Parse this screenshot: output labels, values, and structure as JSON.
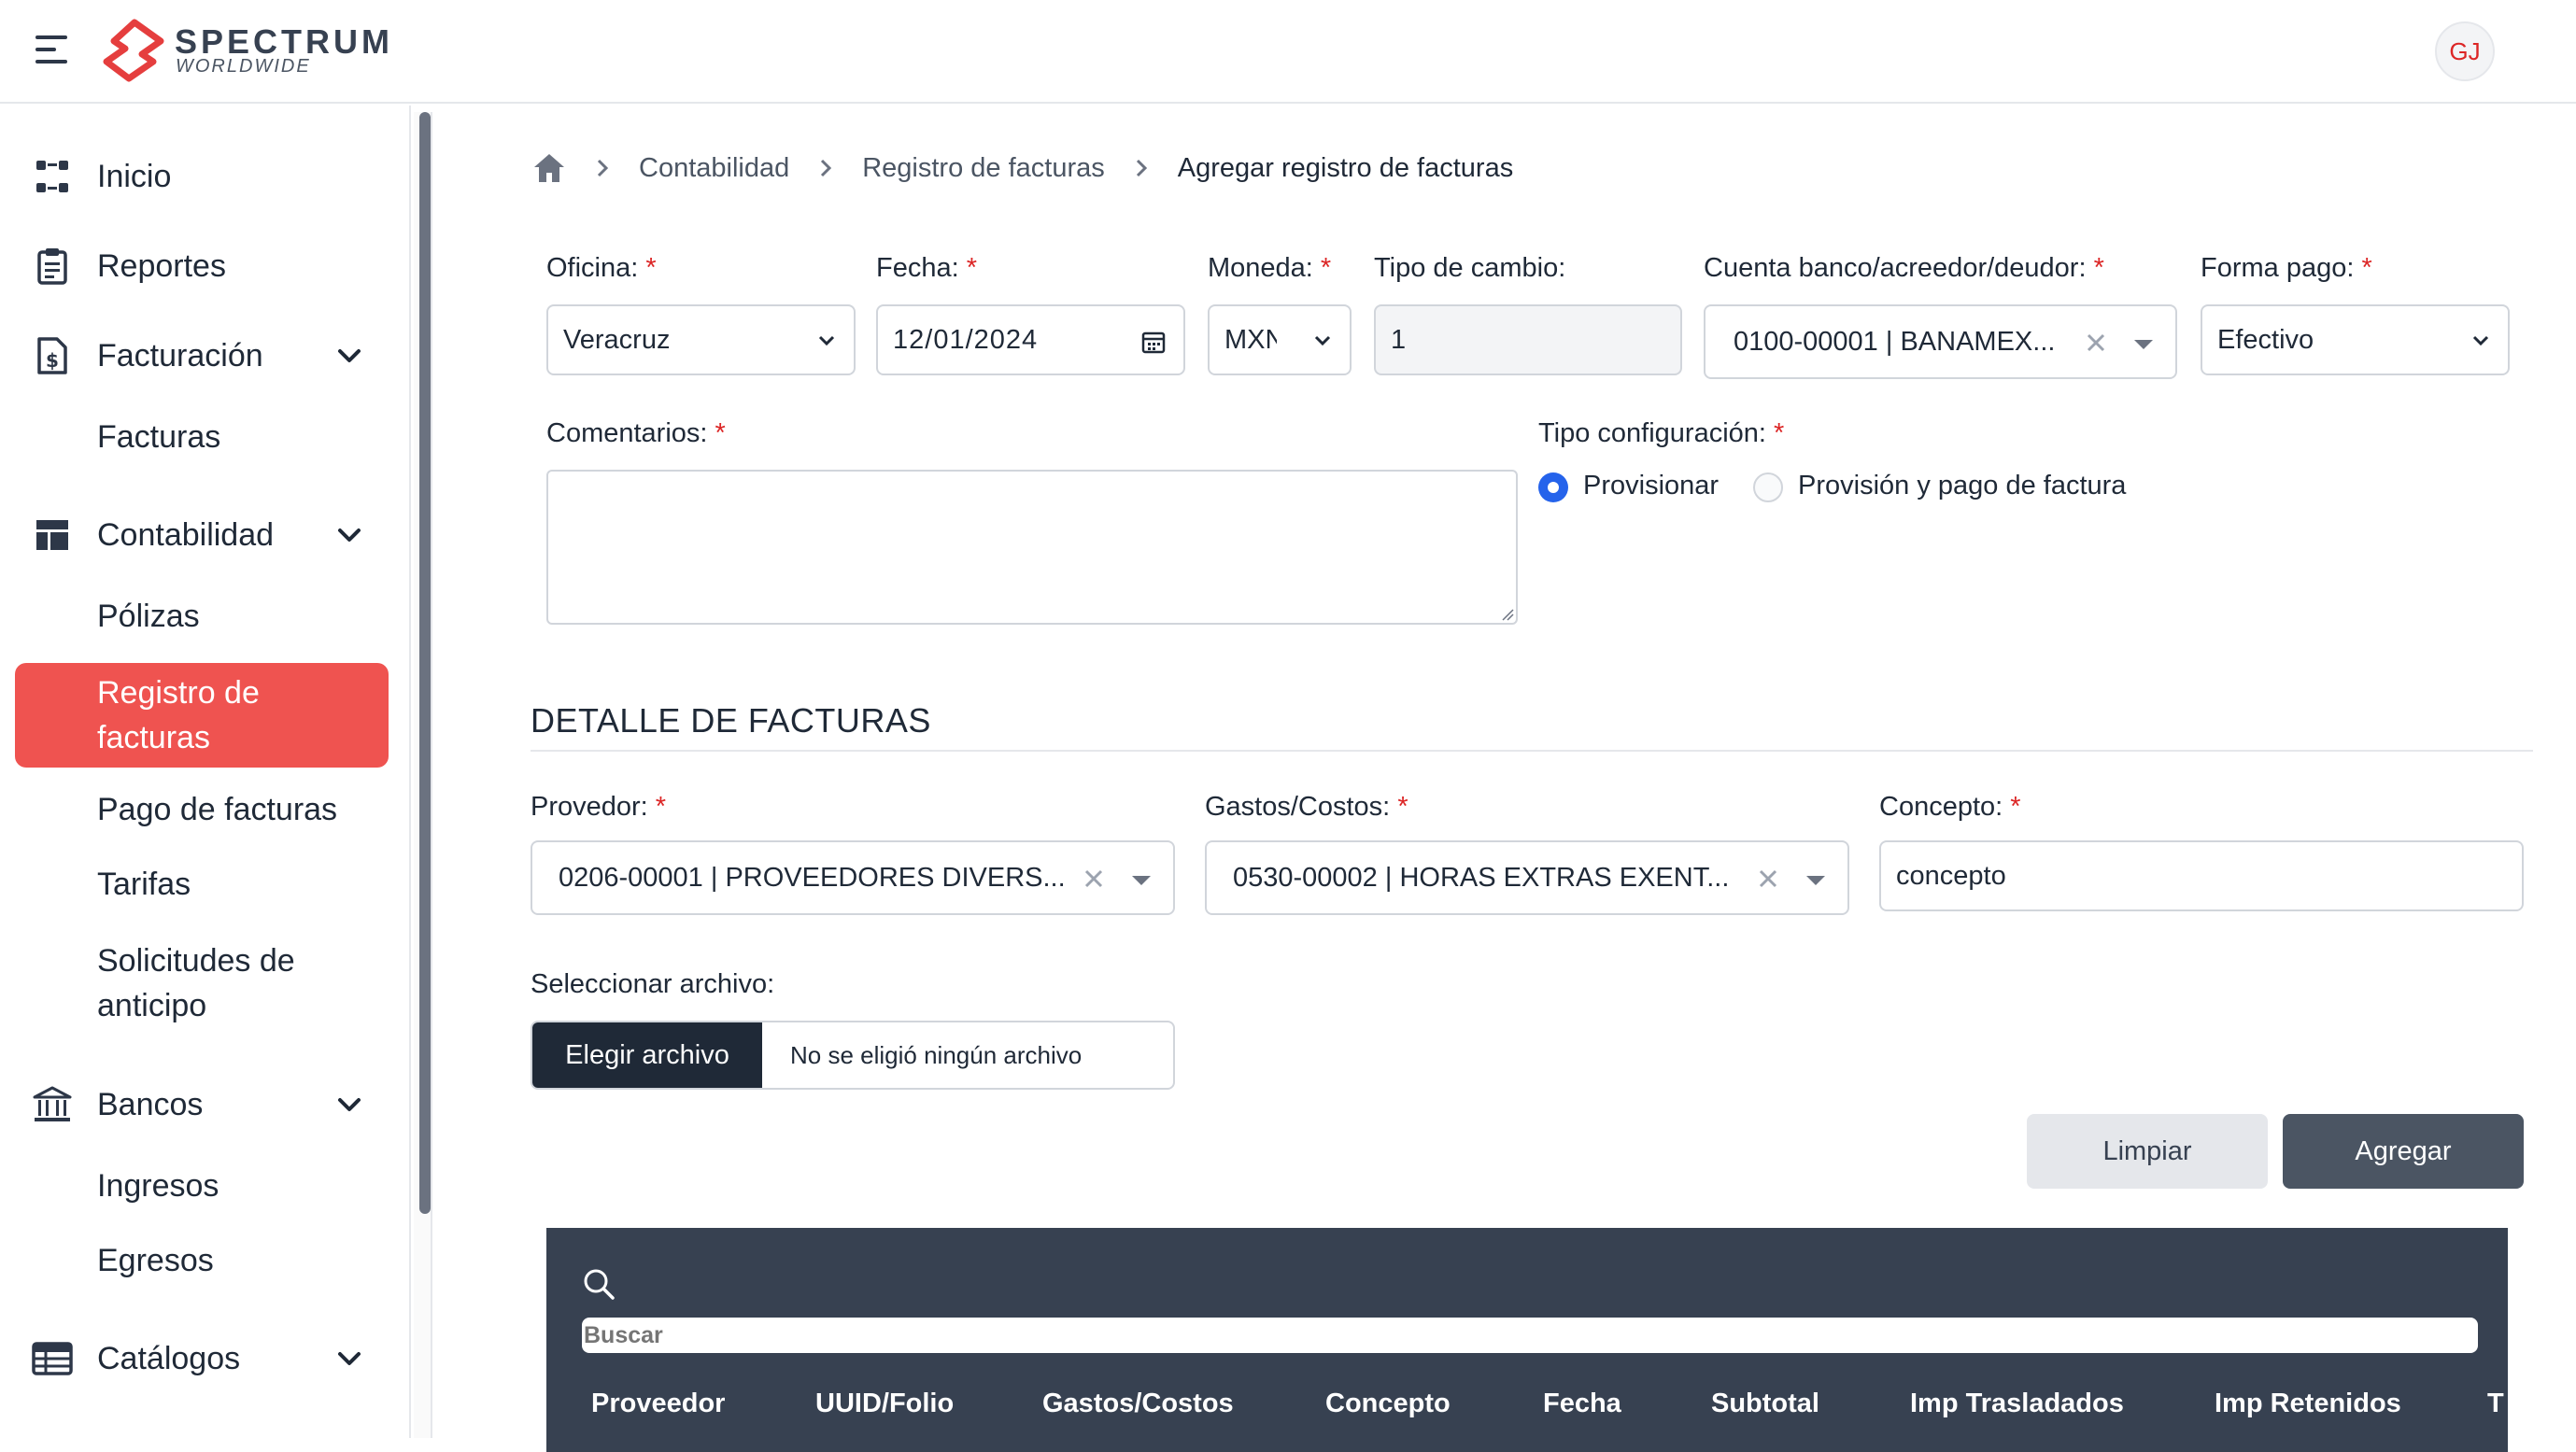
{
  "header": {
    "brand_name": "SPECTRUM",
    "brand_sub": "WORLDWIDE",
    "avatar_initials": "GJ",
    "brand_color": "#e53e3e"
  },
  "sidebar": {
    "items": [
      {
        "label": "Inicio",
        "icon": "dashboard-icon"
      },
      {
        "label": "Reportes",
        "icon": "report-icon"
      },
      {
        "label": "Facturación",
        "icon": "invoice-dollar-icon"
      },
      {
        "label": "Facturas"
      },
      {
        "label": "Contabilidad",
        "icon": "layout-icon"
      },
      {
        "label": "Pólizas"
      },
      {
        "label": "Registro de facturas",
        "active": true
      },
      {
        "label": "Pago de facturas"
      },
      {
        "label": "Tarifas"
      },
      {
        "label": "Solicitudes de anticipo"
      },
      {
        "label": "Bancos",
        "icon": "bank-icon"
      },
      {
        "label": "Ingresos"
      },
      {
        "label": "Egresos"
      },
      {
        "label": "Catálogos",
        "icon": "table-icon"
      }
    ],
    "active_color": "#ef5350"
  },
  "breadcrumb": {
    "items": [
      "Contabilidad",
      "Registro de facturas",
      "Agregar registro de facturas"
    ]
  },
  "form": {
    "oficina": {
      "label": "Oficina:",
      "value": "Veracruz"
    },
    "fecha": {
      "label": "Fecha:",
      "value": "12/01/2024"
    },
    "moneda": {
      "label": "Moneda:",
      "value": "MXN"
    },
    "tipo_cambio": {
      "label": "Tipo de cambio:",
      "value": "1"
    },
    "cuenta": {
      "label": "Cuenta banco/acreedor/deudor:",
      "value": "0100-00001 | BANAMEX..."
    },
    "forma_pago": {
      "label": "Forma pago:",
      "value": "Efectivo"
    },
    "comentarios": {
      "label": "Comentarios:",
      "value": ""
    },
    "tipo_config": {
      "label": "Tipo configuración:",
      "options": [
        "Provisionar",
        "Provisión y pago de factura"
      ],
      "selected": "Provisionar"
    },
    "required_mark": "*"
  },
  "detalle": {
    "title": "DETALLE DE FACTURAS",
    "proveedor": {
      "label": "Provedor:",
      "value": "0206-00001 | PROVEEDORES DIVERS..."
    },
    "gastos": {
      "label": "Gastos/Costos:",
      "value": "0530-00002 | HORAS EXTRAS EXENT..."
    },
    "concepto": {
      "label": "Concepto:",
      "value": "concepto"
    },
    "archivo": {
      "label": "Seleccionar archivo:",
      "button": "Elegir archivo",
      "status": "No se eligió ningún archivo"
    },
    "btn_limpiar": "Limpiar",
    "btn_agregar": "Agregar"
  },
  "table": {
    "search_placeholder": "Buscar",
    "columns": [
      "Proveedor",
      "UUID/Folio",
      "Gastos/Costos",
      "Concepto",
      "Fecha",
      "Subtotal",
      "Imp Trasladados",
      "Imp Retenidos",
      "T"
    ]
  }
}
